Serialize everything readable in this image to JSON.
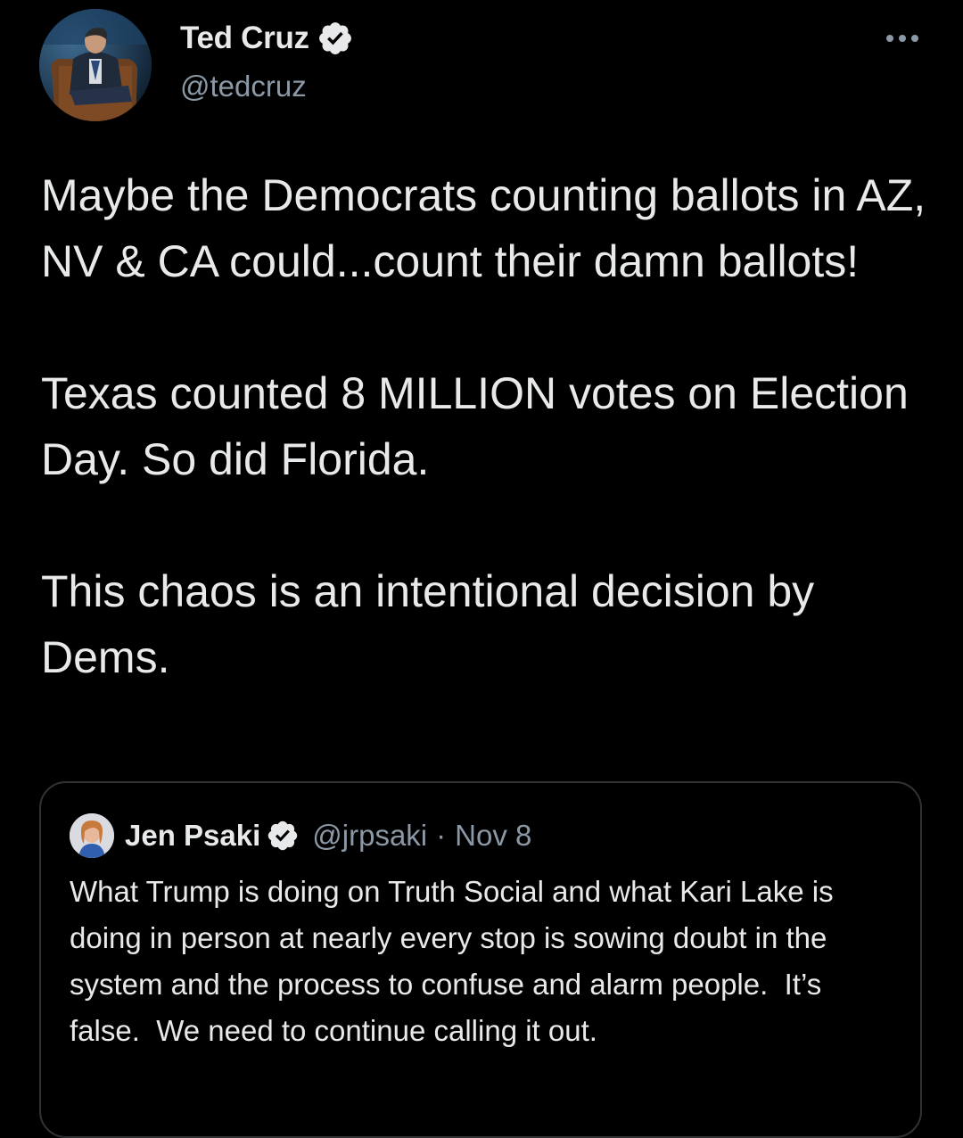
{
  "tweet": {
    "author": {
      "display_name": "Ted Cruz",
      "handle": "@tedcruz",
      "verified": true,
      "avatar_icon": "profile-photo"
    },
    "more_icon": "more-horizontal-icon",
    "paragraphs": [
      "Maybe the Democrats counting ballots in AZ, NV & CA could...count their damn ballots!",
      "Texas counted 8 MILLION votes on Election Day. So did Florida.",
      "This chaos is an intentional decision by Dems."
    ]
  },
  "quoted_tweet": {
    "author": {
      "display_name": "Jen Psaki",
      "handle": "@jrpsaki",
      "separator": "·",
      "date": "Nov 8",
      "verified": true
    },
    "text": "What Trump is doing on Truth Social and what Kari Lake is doing in person at nearly every stop is sowing doubt in the system and the process to confuse and alarm people.  It’s false.  We need to continue calling it out."
  },
  "colors": {
    "background": "#000000",
    "primary_text": "#e7e9ea",
    "secondary_text": "#8b98a5",
    "verified_badge": "#e7e9ea",
    "card_border": "#2f3336"
  }
}
